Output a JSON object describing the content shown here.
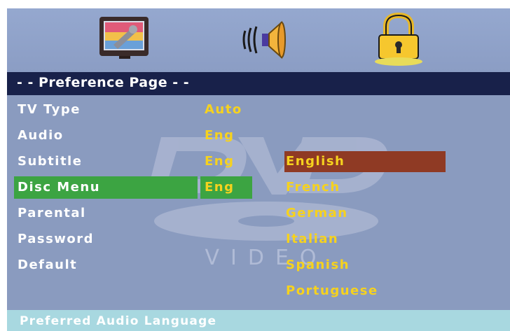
{
  "header": {
    "icons": [
      "tv-setup-icon",
      "speaker-audio-icon",
      "padlock-icon"
    ]
  },
  "page": {
    "title": "- - Preference Page - -"
  },
  "menu": {
    "items": [
      {
        "label": "TV Type",
        "value": "Auto"
      },
      {
        "label": "Audio",
        "value": "Eng"
      },
      {
        "label": "Subtitle",
        "value": "Eng"
      },
      {
        "label": "Disc Menu",
        "value": "Eng"
      },
      {
        "label": "Parental",
        "value": ""
      },
      {
        "label": "Password",
        "value": ""
      },
      {
        "label": "Default",
        "value": ""
      }
    ],
    "highlighted": "Disc Menu"
  },
  "options": {
    "items": [
      "English",
      "French",
      "German",
      "Italian",
      "Spanish",
      "Portuguese"
    ],
    "selected": "English"
  },
  "watermark": {
    "logo_text": "DVD",
    "sub_text": "VIDEO"
  },
  "status_bar": {
    "text": "Preferred Audio Language"
  },
  "colors": {
    "background": "#8a9bbf",
    "title_bar": "#18214a",
    "highlight": "#3ca442",
    "selected_option": "#8f3a24",
    "value_text": "#f6d21e",
    "status_bar": "#a8d8e0"
  }
}
